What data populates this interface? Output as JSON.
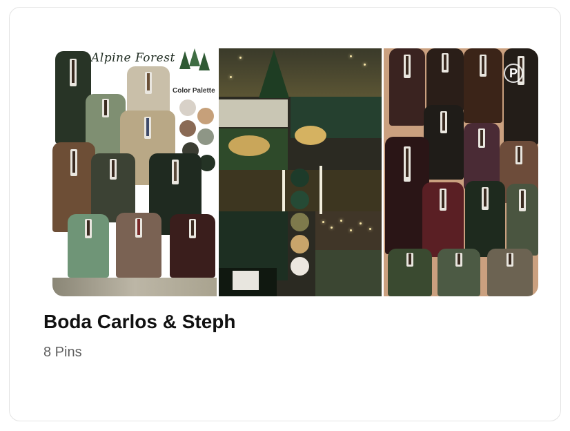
{
  "board": {
    "title": "Boda Carlos & Steph",
    "pin_count": "8 Pins"
  },
  "collage": {
    "panel1": {
      "title": "Alpine Forest",
      "subtitle": "Color Palette",
      "swatches": [
        "#d8d1c8",
        "#c6a07a",
        "#8a6a55",
        "#8e9686",
        "#3b3d33",
        "#243325"
      ]
    },
    "panel2": {
      "palette": [
        "#1d3b2a",
        "#254a35",
        "#7e7a4c",
        "#c8a56b",
        "#ece7df"
      ]
    },
    "panel3": {
      "logo_icon": "pinterest-icon",
      "logo_glyph": "P"
    }
  },
  "colors": {
    "title_text": "#111111",
    "count_text": "#5f5f5f",
    "card_border": "#e3e3e3"
  }
}
